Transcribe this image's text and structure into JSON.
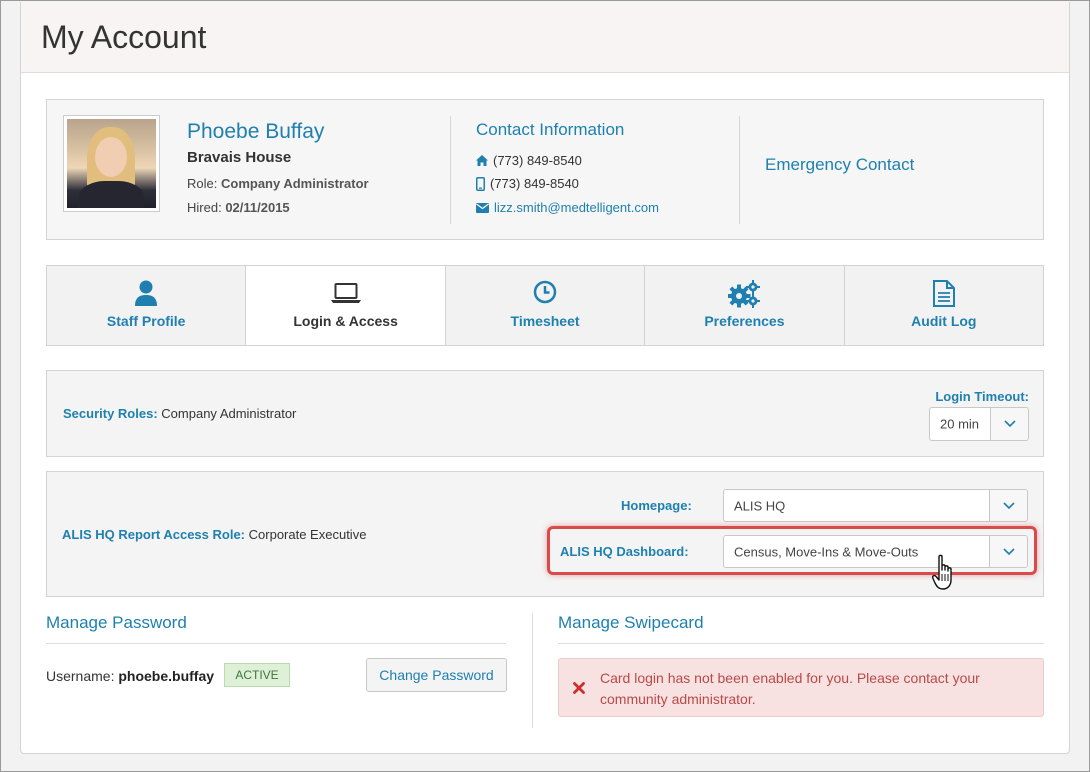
{
  "page": {
    "title": "My Account"
  },
  "profile": {
    "name": "Phoebe Buffay",
    "community": "Bravais House",
    "role_label": "Role:",
    "role_value": "Company Administrator",
    "hired_label": "Hired:",
    "hired_value": "02/11/2015"
  },
  "contact": {
    "title": "Contact Information",
    "home_phone": "(773) 849-8540",
    "mobile_phone": "(773) 849-8540",
    "email": "lizz.smith@medtelligent.com"
  },
  "emergency": {
    "title": "Emergency Contact"
  },
  "tabs": [
    {
      "label": "Staff Profile",
      "icon": "user-icon"
    },
    {
      "label": "Login & Access",
      "icon": "laptop-icon"
    },
    {
      "label": "Timesheet",
      "icon": "clock-icon"
    },
    {
      "label": "Preferences",
      "icon": "gears-icon"
    },
    {
      "label": "Audit Log",
      "icon": "document-icon"
    }
  ],
  "access": {
    "security_roles_label": "Security Roles:",
    "security_roles_value": "Company Administrator",
    "login_timeout_label": "Login Timeout:",
    "login_timeout_value": "20 min",
    "report_role_label": "ALIS HQ Report Access Role:",
    "report_role_value": "Corporate Executive",
    "homepage_label": "Homepage:",
    "homepage_value": "ALIS HQ",
    "dashboard_label": "ALIS HQ Dashboard:",
    "dashboard_value": "Census, Move-Ins & Move-Outs"
  },
  "password": {
    "title": "Manage Password",
    "username_label": "Username:",
    "username_value": "phoebe.buffay",
    "status": "ACTIVE",
    "change_label": "Change Password"
  },
  "swipecard": {
    "title": "Manage Swipecard",
    "message": "Card login has not been enabled for you. Please contact your community administrator."
  },
  "colors": {
    "accent": "#1f80b0",
    "highlight": "#d74b4b",
    "error": "#b94a48"
  }
}
